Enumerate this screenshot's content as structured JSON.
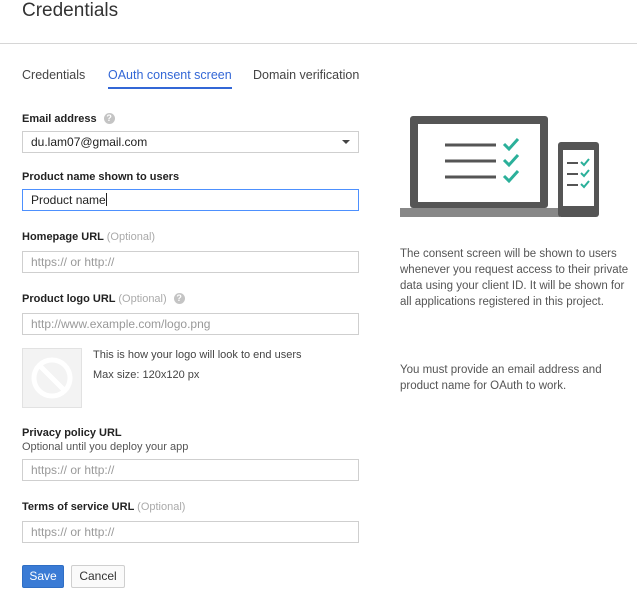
{
  "page": {
    "title": "Credentials"
  },
  "tabs": [
    {
      "label": "Credentials"
    },
    {
      "label": "OAuth consent screen"
    },
    {
      "label": "Domain verification"
    }
  ],
  "active_tab_index": 1,
  "form": {
    "email": {
      "label": "Email address",
      "value": "du.lam07@gmail.com"
    },
    "product_name": {
      "label": "Product name shown to users",
      "value": "Product name"
    },
    "homepage": {
      "label": "Homepage URL",
      "optional": "(Optional)",
      "placeholder": "https:// or http://"
    },
    "logo": {
      "label": "Product logo URL",
      "optional": "(Optional)",
      "placeholder": "http://www.example.com/logo.png",
      "preview_text": "This is how your logo will look to end users",
      "size_text": "Max size: 120x120 px"
    },
    "privacy": {
      "label": "Privacy policy URL",
      "sublabel": "Optional until you deploy your app",
      "placeholder": "https:// or http://"
    },
    "tos": {
      "label": "Terms of service URL",
      "optional": "(Optional)",
      "placeholder": "https:// or http://"
    }
  },
  "buttons": {
    "save": "Save",
    "cancel": "Cancel"
  },
  "sidebar": {
    "paragraph1": "The consent screen will be shown to users whenever you request access to their private data using your client ID. It will be shown for all applications registered in this project.",
    "paragraph2": "You must provide an email address and product name for OAuth to work."
  },
  "colors": {
    "accent": "#3367d6",
    "check": "#2bb09a",
    "device": "#555555"
  },
  "icons": {
    "help": "help-circle-icon",
    "dropdown": "chevron-down-icon",
    "logo_placeholder": "no-image-icon"
  }
}
